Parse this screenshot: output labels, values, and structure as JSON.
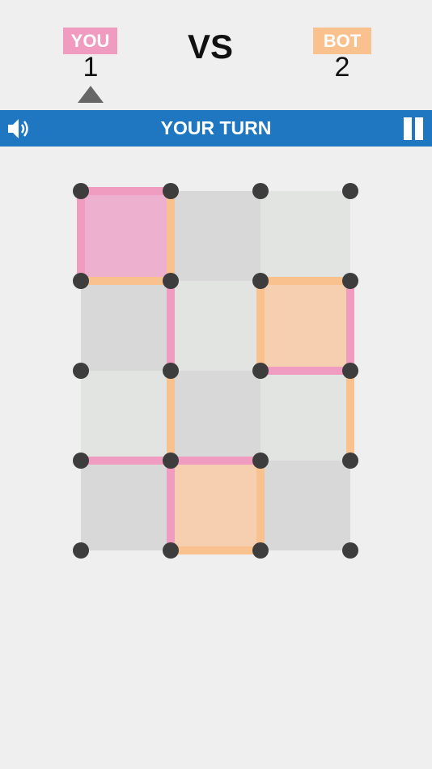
{
  "scoreboard": {
    "you_label": "YOU",
    "you_score": "1",
    "vs_label": "VS",
    "bot_label": "BOT",
    "bot_score": "2",
    "active_player": "you"
  },
  "status_bar": {
    "turn_text": "YOUR TURN",
    "sound_icon": "speaker-icon",
    "pause_icon": "pause-icon"
  },
  "colors": {
    "you": "#f09cc1",
    "bot": "#f8c18e",
    "you_box": "#edb1cf",
    "bot_box": "#f6cfb0",
    "cell_dark": "#d8d8d8",
    "cell_light": "#e1e4e0",
    "dot": "#3d3d3d",
    "bar": "#1f77c2"
  },
  "board": {
    "dots_cols": 4,
    "dots_rows": 5,
    "cells": [
      [
        "you",
        "dark",
        "light"
      ],
      [
        "dark",
        "light",
        "bot"
      ],
      [
        "light",
        "dark",
        "light"
      ],
      [
        "dark",
        "bot",
        "dark"
      ]
    ],
    "horizontal_edges": [
      [
        "you",
        "",
        ""
      ],
      [
        "bot",
        "",
        "bot"
      ],
      [
        "",
        "",
        "you"
      ],
      [
        "you",
        "you",
        ""
      ],
      [
        "",
        "bot",
        ""
      ]
    ],
    "vertical_edges": [
      [
        "you",
        "bot",
        "",
        ""
      ],
      [
        "",
        "you",
        "bot",
        "you"
      ],
      [
        "",
        "bot",
        "",
        "bot"
      ],
      [
        "",
        "you",
        "bot",
        ""
      ]
    ]
  }
}
